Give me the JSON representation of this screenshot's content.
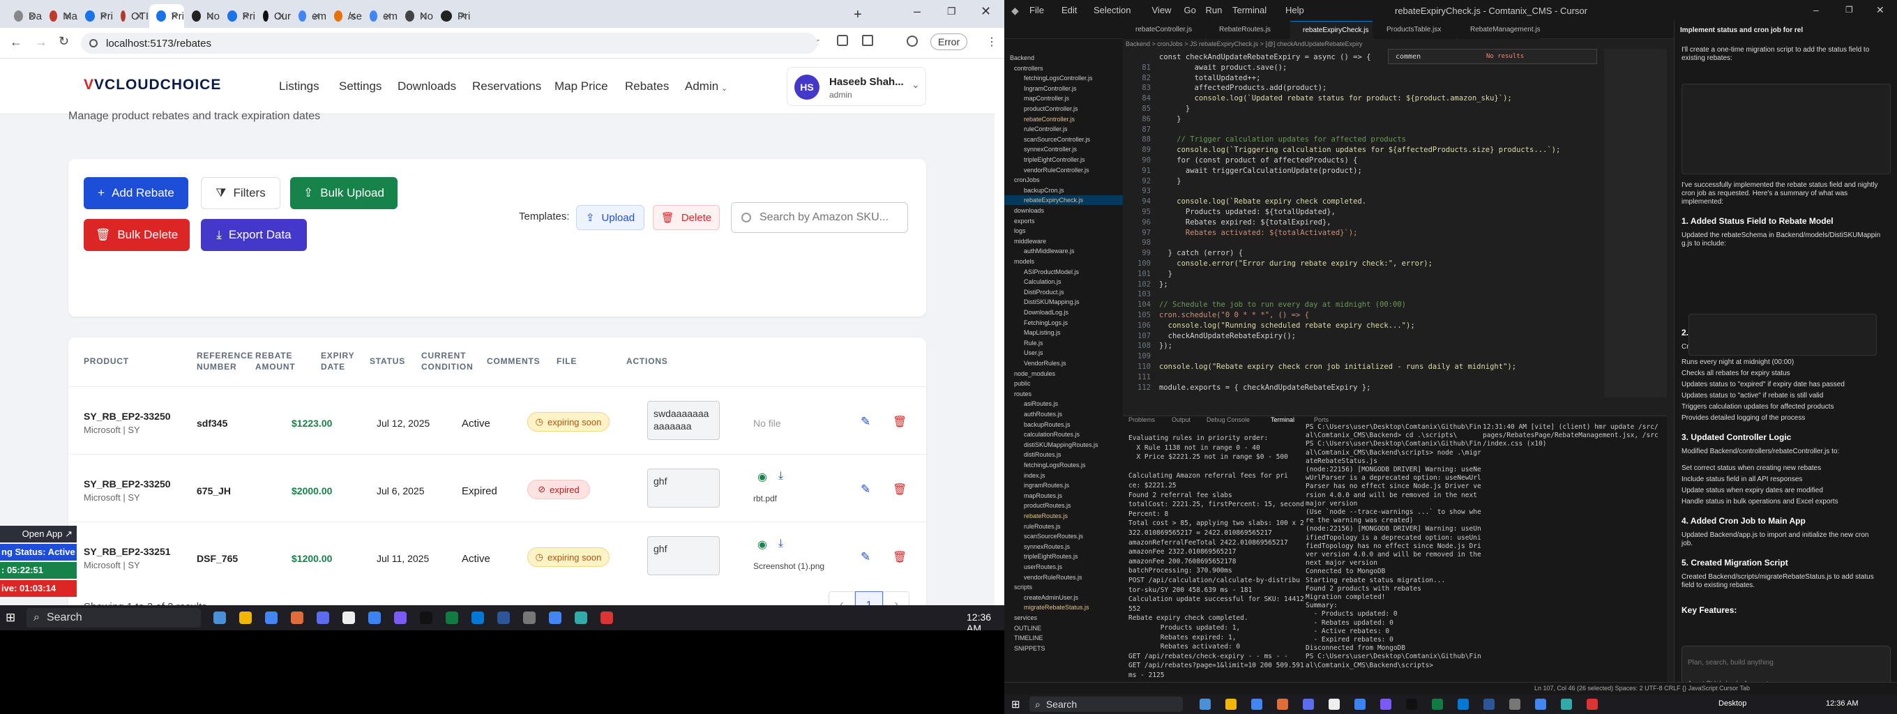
{
  "browser": {
    "tabs": [
      {
        "label": "Da",
        "active": false
      },
      {
        "label": "Ma",
        "active": false
      },
      {
        "label": "Pri",
        "active": false
      },
      {
        "label": "OTI",
        "active": false
      },
      {
        "label": "Pri",
        "active": true
      },
      {
        "label": "No",
        "active": false
      },
      {
        "label": "Pri",
        "active": false
      },
      {
        "label": "Cur",
        "active": false
      },
      {
        "label": "em",
        "active": false
      },
      {
        "label": "/se",
        "active": false
      },
      {
        "label": "em",
        "active": false
      },
      {
        "label": "No",
        "active": false
      },
      {
        "label": "Pri",
        "active": false
      }
    ],
    "url": "localhost:5173/rebates",
    "error_label": "Error"
  },
  "app": {
    "logo": "VCLOUDCHOICE",
    "nav": [
      "Listings",
      "Settings",
      "Downloads",
      "Reservations",
      "Map Price",
      "Rebates",
      "Admin"
    ],
    "user": {
      "initials": "HS",
      "name": "Haseeb Shah...",
      "role": "admin"
    },
    "subtitle": "Manage product rebates and track expiration dates",
    "buttons": {
      "add": "Add Rebate",
      "filters": "Filters",
      "bulk_upload": "Bulk Upload",
      "bulk_delete": "Bulk Delete",
      "export": "Export Data"
    },
    "templates": {
      "label": "Templates:",
      "upload": "Upload",
      "delete": "Delete"
    },
    "search_placeholder": "Search by Amazon SKU...",
    "columns": [
      "PRODUCT",
      "REFERENCE NUMBER",
      "REBATE AMOUNT",
      "EXPIRY DATE",
      "STATUS",
      "CURRENT CONDITION",
      "COMMENTS",
      "FILE",
      "ACTIONS"
    ],
    "rows": [
      {
        "product": "SY_RB_EP2-33250",
        "brand": "Microsoft | SY",
        "ref": "sdf345",
        "amount": "$1223.00",
        "expiry": "Jul 12, 2025",
        "status": "Active",
        "condition": "expiring soon",
        "comment": "swdaaaaaaaaaaaaaa",
        "file": "No file"
      },
      {
        "product": "SY_RB_EP2-33250",
        "brand": "Microsoft | SY",
        "ref": "675_JH",
        "amount": "$2000.00",
        "expiry": "Jul 6, 2025",
        "status": "Expired",
        "condition": "expired",
        "comment": "ghf",
        "file": "rbt.pdf"
      },
      {
        "product": "SY_RB_EP2-33251",
        "brand": "Microsoft | SY",
        "ref": "DSF_765",
        "amount": "$1200.00",
        "expiry": "Jul 11, 2025",
        "status": "Active",
        "condition": "expiring soon",
        "comment": "ghf",
        "file": "Screenshot (1).png"
      }
    ],
    "showing": "Showing 1 to 3 of 3 results",
    "page": "1"
  },
  "overlay": {
    "open_app": "Open App ↗",
    "status_line": "ng Status: Active",
    "time1": ": 05:22:51",
    "time2": "ive: 01:03:14"
  },
  "taskbar_left": {
    "search": "Search",
    "clock": "12:36 AM"
  },
  "vscode": {
    "menu": [
      "File",
      "Edit",
      "Selection",
      "View",
      "Go",
      "Run",
      "Terminal",
      "Help"
    ],
    "title": "rebateExpiryCheck.js - Comtanix_CMS - Cursor",
    "tabs": [
      "rebateController.js",
      "RebateRoutes.js",
      "rebateExpiryCheck.js",
      "ProductsTable.jsx",
      "RebateManagement.jsx"
    ],
    "breadcrumb": "Backend > cronJobs > JS rebateExpiryCheck.js > [@] checkAndUpdateRebateExpiry",
    "find_text": "commen",
    "find_result": "No results",
    "files": [
      "Backend",
      "controllers",
      "fetchingLogsController.js",
      "IngramController.js",
      "mapController.js",
      "productController.js",
      "rebateController.js",
      "ruleController.js",
      "scanSourceController.js",
      "synnexController.js",
      "tripleEightController.js",
      "vendorRuleController.js",
      "cronJobs",
      "backupCron.js",
      "rebateExpiryCheck.js",
      "downloads",
      "exports",
      "logs",
      "middleware",
      "authMiddleware.js",
      "models",
      "ASIProductModel.js",
      "Calculation.js",
      "DistiProduct.js",
      "DistiSKUMapping.js",
      "DownloadLog.js",
      "FetchingLogs.js",
      "MapListing.js",
      "Rule.js",
      "User.js",
      "VendorRules.js",
      "node_modules",
      "public",
      "routes",
      "asiRoutes.js",
      "authRoutes.js",
      "backupRoutes.js",
      "calculationRoutes.js",
      "distiSKUMappingRoutes.js",
      "distiRoutes.js",
      "fetchingLogsRoutes.js",
      "index.js",
      "ingramRoutes.js",
      "mapRoutes.js",
      "productRoutes.js",
      "rebateRoutes.js",
      "ruleRoutes.js",
      "scanSourceRoutes.js",
      "synnexRoutes.js",
      "tripleEightRoutes.js",
      "userRoutes.js",
      "vendorRuleRoutes.js",
      "scripts",
      "createAdminUser.js",
      "migrateRebateStatus.js",
      "services",
      "OUTLINE",
      "TIMELINE",
      "SNIPPETS"
    ],
    "code": [
      {
        "n": "",
        "t": "const checkAndUpdateRebateExpiry = async () => {"
      },
      {
        "n": "81",
        "t": "        await product.save();"
      },
      {
        "n": "82",
        "t": "        totalUpdated++;"
      },
      {
        "n": "83",
        "t": "        affectedProducts.add(product);"
      },
      {
        "n": "84",
        "t": "        console.log(`Updated rebate status for product: ${product.amazon_sku}`);"
      },
      {
        "n": "85",
        "t": "      }"
      },
      {
        "n": "86",
        "t": "    }"
      },
      {
        "n": "87",
        "t": ""
      },
      {
        "n": "88",
        "t": "    // Trigger calculation updates for affected products"
      },
      {
        "n": "89",
        "t": "    console.log(`Triggering calculation updates for ${affectedProducts.size} products...`);"
      },
      {
        "n": "90",
        "t": "    for (const product of affectedProducts) {"
      },
      {
        "n": "91",
        "t": "      await triggerCalculationUpdate(product);"
      },
      {
        "n": "92",
        "t": "    }"
      },
      {
        "n": "93",
        "t": ""
      },
      {
        "n": "94",
        "t": "    console.log(`Rebate expiry check completed."
      },
      {
        "n": "95",
        "t": "      Products updated: ${totalUpdated},"
      },
      {
        "n": "96",
        "t": "      Rebates expired: ${totalExpired},"
      },
      {
        "n": "97",
        "t": "      Rebates activated: ${totalActivated}`);"
      },
      {
        "n": "98",
        "t": ""
      },
      {
        "n": "99",
        "t": "  } catch (error) {"
      },
      {
        "n": "100",
        "t": "    console.error(\"Error during rebate expiry check:\", error);"
      },
      {
        "n": "101",
        "t": "  }"
      },
      {
        "n": "102",
        "t": "};"
      },
      {
        "n": "103",
        "t": ""
      },
      {
        "n": "104",
        "t": "// Schedule the job to run every day at midnight (00:00)"
      },
      {
        "n": "105",
        "t": "cron.schedule(\"0 0 * * *\", () => {"
      },
      {
        "n": "106",
        "t": "  console.log(\"Running scheduled rebate expiry check...\");"
      },
      {
        "n": "107",
        "t": "  checkAndUpdateRebateExpiry();"
      },
      {
        "n": "108",
        "t": "});"
      },
      {
        "n": "109",
        "t": ""
      },
      {
        "n": "110",
        "t": "console.log(\"Rebate expiry check cron job initialized - runs daily at midnight\");"
      },
      {
        "n": "111",
        "t": ""
      },
      {
        "n": "112",
        "t": "module.exports = { checkAndUpdateRebateExpiry };"
      }
    ],
    "panel_tabs": [
      "Problems",
      "Output",
      "Debug Console",
      "Terminal",
      "Ports"
    ],
    "term1": [
      "Evaluating rules in priority order:",
      "  X Rule 1138 not in range 0 - 40",
      "  X Price $2221.25 not in range $0 - 500",
      "",
      "Calculating Amazon referral fees for pri",
      "ce: $2221.25",
      "Found 2 referral fee slabs",
      "totalCost: 2221.25, firstPercent: 15, second",
      "Percent: 8",
      "Total cost > 85, applying two slabs: 100 x 2",
      "322.010869565217 = 2422.010869565217",
      "amazonReferralFeeTotal 2422.010869565217",
      "amazonFee 2322.010869565217",
      "amazonFee 200.7608695652178",
      "batchProcessing: 370.900ms",
      "POST /api/calculation/calculate-by-distribu",
      "tor-sku/SY 200 458.639 ms - 181",
      "Calculation update successful for SKU: 14412",
      "552",
      "Rebate expiry check completed.",
      "        Products updated: 1,",
      "        Rebates expired: 1,",
      "        Rebates activated: 0",
      "GET /api/rebates/check-expiry - - ms - -",
      "GET /api/rebates?page=1&limit=10 200 509.591",
      "ms - 2125"
    ],
    "term2": [
      "PS C:\\Users\\user\\Desktop\\Comtanix\\Github\\Fin",
      "al\\Comtanix_CMS\\Backend> cd .\\scripts\\",
      "PS C:\\Users\\user\\Desktop\\Comtanix\\Github\\Fin",
      "al\\Comtanix_CMS\\Backend\\scripts> node .\\migr",
      "ateRebateStatus.js",
      "(node:22156) [MONGODB DRIVER] Warning: useNe",
      "wUrlParser is a deprecated option: useNewUrl",
      "Parser has no effect since Node.js Driver ve",
      "rsion 4.0.0 and will be removed in the next",
      "major version",
      "(Use `node --trace-warnings ...` to show whe",
      "re the warning was created)",
      "(node:22156) [MONGODB DRIVER] Warning: useUn",
      "ifiedTopology is a deprecated option: useUni",
      "fiedTopology has no effect since Node.js Dri",
      "ver version 4.0.0 and will be removed in the",
      "next major version",
      "Connected to MongoDB",
      "Starting rebate status migration...",
      "Found 2 products with rebates",
      "Migration completed!",
      "Summary:",
      "  - Products updated: 0",
      "  - Rebates updated: 0",
      "  - Active rebates: 0",
      "  - Expired rebates: 0",
      "Disconnected from MongoDB",
      "PS C:\\Users\\user\\Desktop\\Comtanix\\Github\\Fin",
      "al\\Comtanix_CMS\\Backend\\scripts>"
    ],
    "term3": [
      "12:31:40 AM [vite] (client) hmr update /src/",
      "pages/RebatesPage/RebateManagement.jsx, /src",
      "/index.css (x10)"
    ],
    "chat_title": "Implement status and cron job for rel",
    "chat": [
      "I'll create a one-time migration script to add the status field to",
      "existing rebates:",
      "I've successfully implemented the rebate status field and nightly",
      "cron job as requested. Here's a summary of what was",
      "implemented:",
      "1. Added Status Field to Rebate Model",
      "Updated the rebateSchema in Backend/models/DistiSKUMappin",
      "g.js to include:",
      "2. Created Nightly Cron Job",
      "Created Backend/cronJobs/rebateExpiryCheck.js that:",
      "Runs every night at midnight (00:00)",
      "Checks all rebates for expiry status",
      "Updates status to \"expired\" if expiry date has passed",
      "Updates status to \"active\" if rebate is still valid",
      "Triggers calculation updates for affected products",
      "Provides detailed logging of the process",
      "3. Updated Controller Logic",
      "Modified Backend/controllers/rebateController.js to:",
      "Set correct status when creating new rebates",
      "Include status field in all API responses",
      "Update status when expiry dates are modified",
      "Handle status in bulk operations and Excel exports",
      "4. Added Cron Job to Main App",
      "Updated Backend/app.js to import and initialize the new cron",
      "job.",
      "5. Created Migration Script",
      "Created Backend/scripts/migrateRebateStatus.js to add status",
      "field to existing rebates.",
      "Key Features:"
    ],
    "chat_input": "Plan, search, build anything",
    "agent": "Agent  Ctrl+I   claude-4-sonnet",
    "status_bar": "Ln 107, Col 46 (26 selected)   Spaces: 2   UTF-8   CRLF   {} JavaScript   Cursor Tab"
  },
  "taskbar_right": {
    "search": "Search",
    "desktop": "Desktop",
    "clock": "12:36 AM"
  },
  "colors": {
    "navy": "#1d4ed8",
    "green": "#16834a",
    "red": "#dc2626",
    "purple": "#4338ca",
    "amber": "#d97706"
  }
}
